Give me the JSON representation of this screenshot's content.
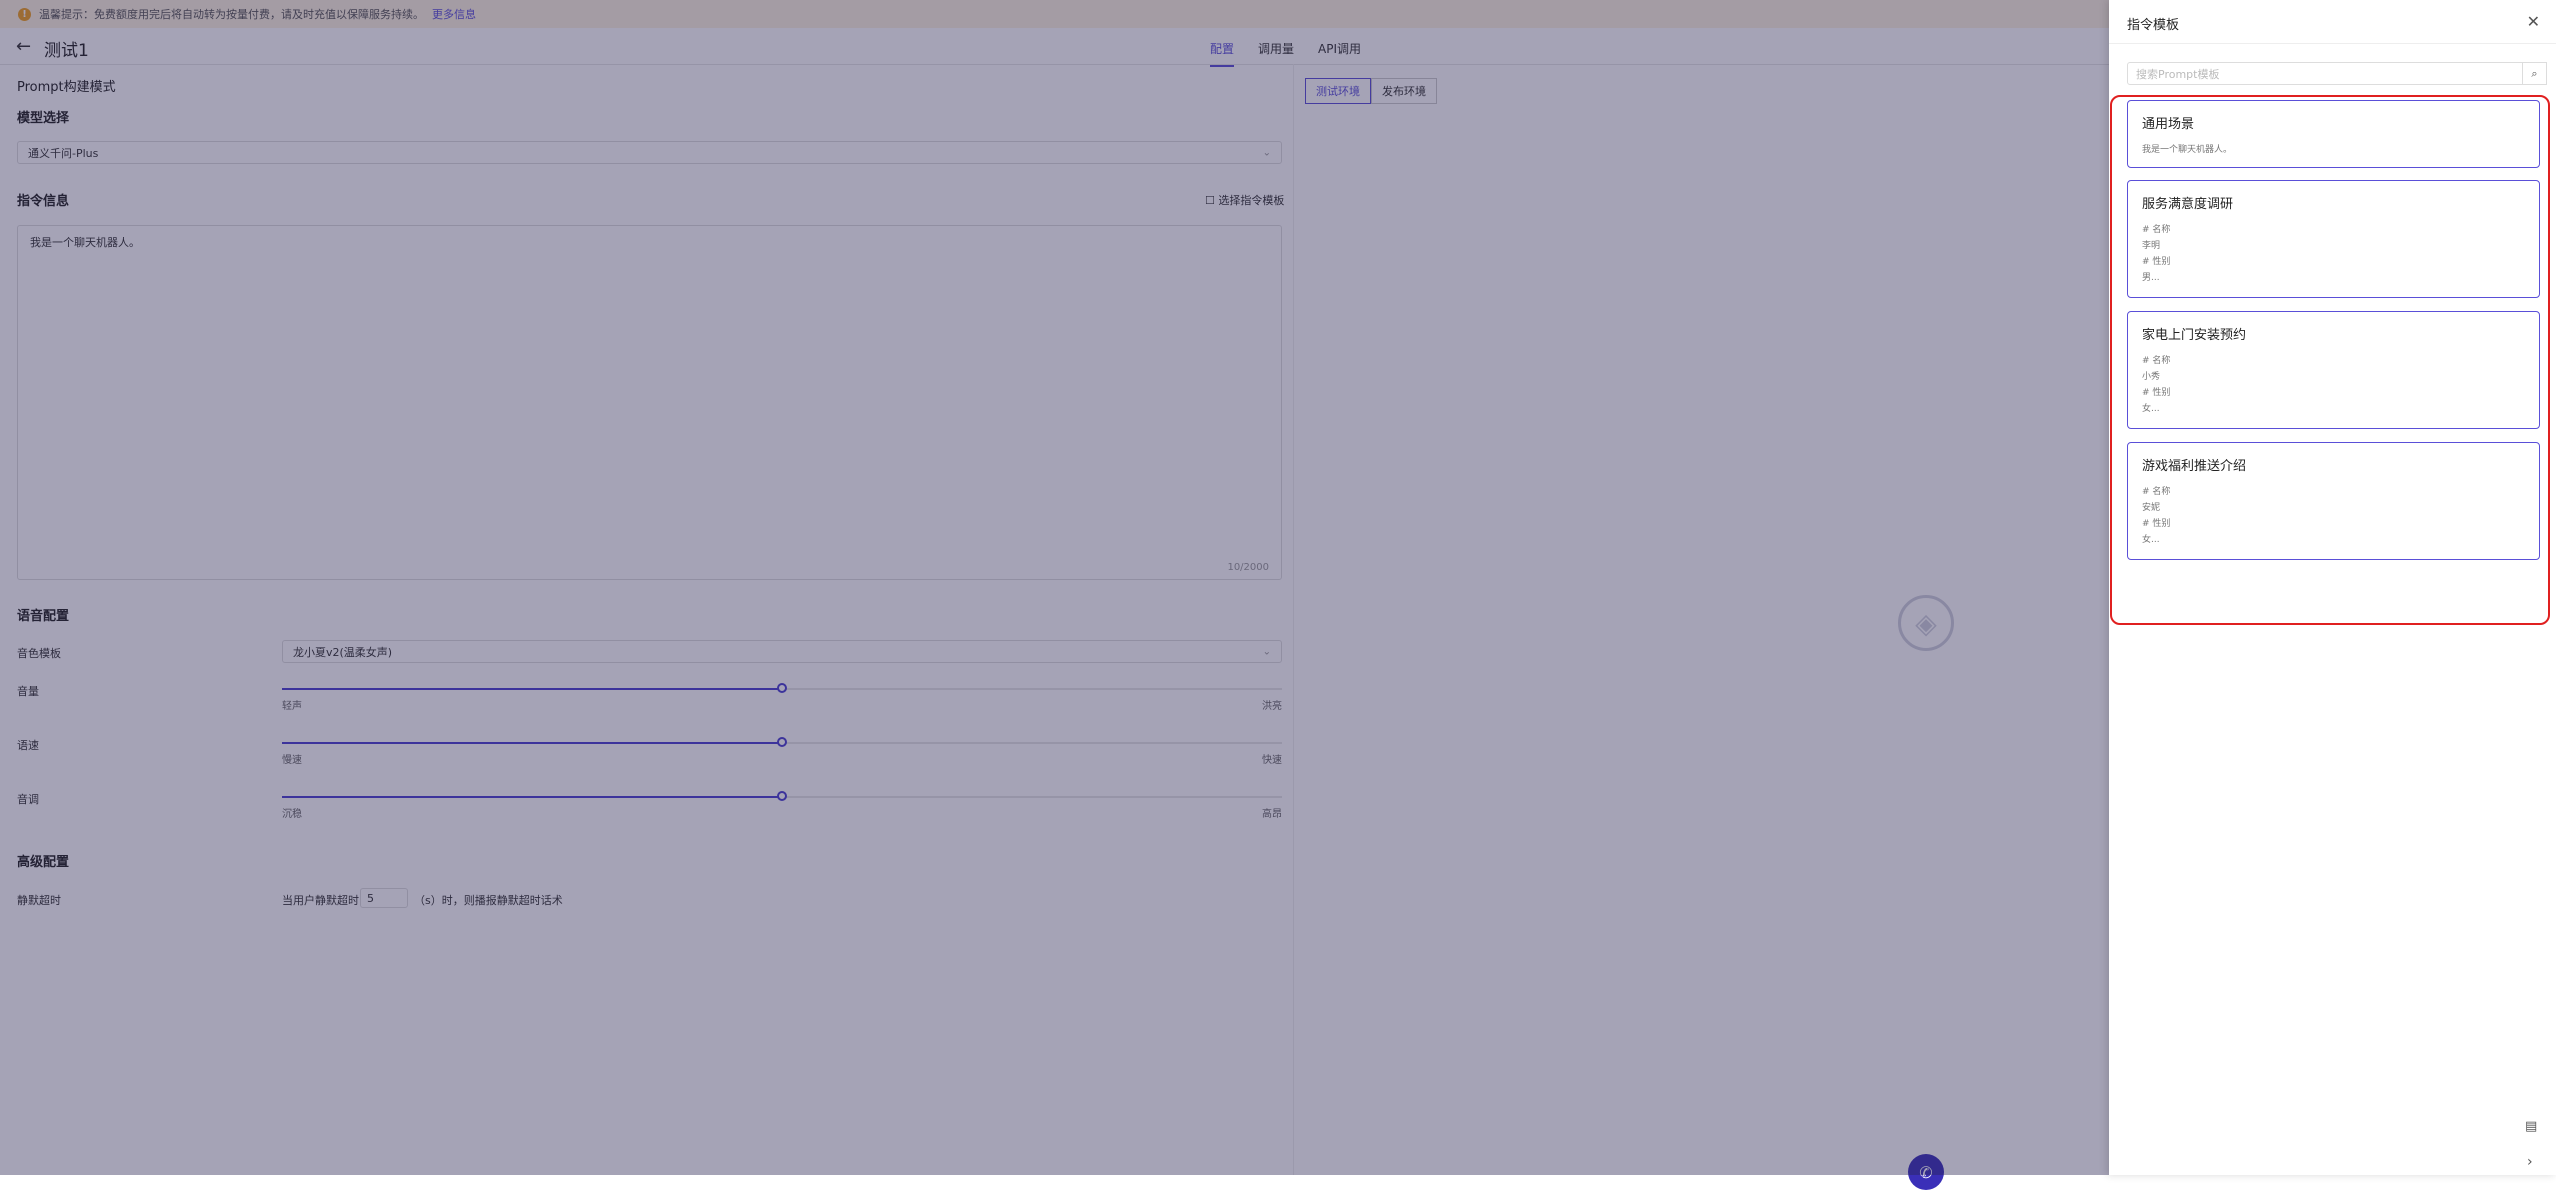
{
  "notice": {
    "icon": "warning-icon",
    "text": "温馨提示：免费额度用完后将自动转为按量付费，请及时充值以保障服务持续。",
    "more": "更多信息"
  },
  "header": {
    "title": "测试1",
    "tabs": [
      {
        "label": "配置",
        "active": true
      },
      {
        "label": "调用量",
        "active": false
      },
      {
        "label": "API调用",
        "active": false
      }
    ]
  },
  "config": {
    "mode_title": "Prompt构建模式",
    "model_section": "模型选择",
    "model_value": "通义千问-Plus",
    "instruction_section": "指令信息",
    "choose_template": "选择指令模板",
    "instruction_text": "我是一个聊天机器人。",
    "char_count": "10/2000",
    "voice_section": "语音配置",
    "voice_template_label": "音色模板",
    "voice_template_value": "龙小夏v2(温柔女声)",
    "volume_label": "音量",
    "volume_min": "轻声",
    "volume_max": "洪亮",
    "volume_value": 0.5,
    "speed_label": "语速",
    "speed_min": "慢速",
    "speed_max": "快速",
    "speed_value": 0.5,
    "pitch_label": "音调",
    "pitch_min": "沉稳",
    "pitch_max": "高昂",
    "pitch_value": 0.5,
    "advanced_section": "高级配置",
    "silence_label": "静默超时",
    "silence_prefix": "当用户静默超时",
    "silence_value": "5",
    "silence_suffix": "（s）时，则播报静默超时话术"
  },
  "env_tabs": [
    {
      "label": "测试环境",
      "active": true
    },
    {
      "label": "发布环境",
      "active": false
    }
  ],
  "drawer": {
    "title": "指令模板",
    "search_placeholder": "搜索Prompt模板",
    "cards": [
      {
        "title": "通用场景",
        "lines": [
          "我是一个聊天机器人。"
        ]
      },
      {
        "title": "服务满意度调研",
        "lines": [
          "# 名称",
          "李明",
          "# 性别",
          "男..."
        ]
      },
      {
        "title": "家电上门安装预约",
        "lines": [
          "# 名称",
          "小秀",
          "# 性别",
          "女..."
        ]
      },
      {
        "title": "游戏福利推送介绍",
        "lines": [
          "# 名称",
          "安妮",
          "# 性别",
          "女..."
        ]
      }
    ]
  }
}
